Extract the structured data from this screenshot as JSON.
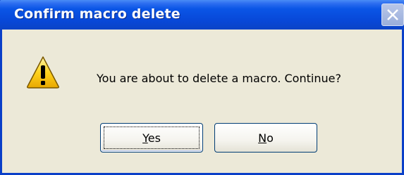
{
  "window": {
    "title": "Confirm macro delete",
    "close_icon": "close-icon",
    "titlebar_color": "#0a55e6"
  },
  "content": {
    "icon": "warning-icon",
    "message": "You are about to delete a macro.  Continue?"
  },
  "buttons": {
    "yes": {
      "mnemonic": "Y",
      "rest": "es",
      "default": true
    },
    "no": {
      "mnemonic": "N",
      "rest": "o",
      "default": false
    }
  }
}
